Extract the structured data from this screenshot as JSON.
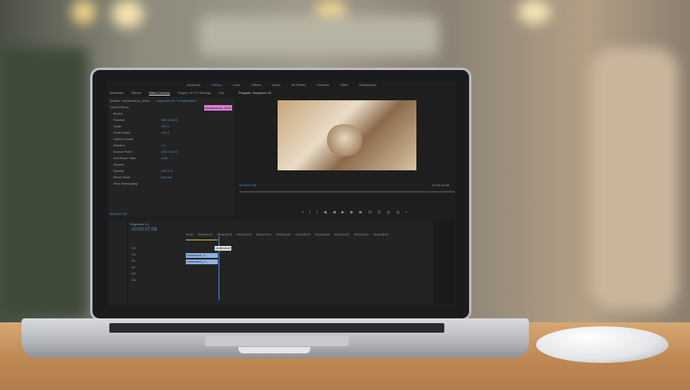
{
  "workspaces": [
    "Assembly",
    "Editing",
    "Color",
    "Effects",
    "Audio",
    "All Panels",
    "Libraries",
    "Titles",
    "Workspaces"
  ],
  "active_workspace": "Editing",
  "panel_tabs": [
    "Metadata",
    "Effects",
    "Effect Controls",
    "Project: SCTV Settings",
    "Sou"
  ],
  "program_tab": "Program: Sequence 01",
  "effect_controls": {
    "master": "Master * shutterstock_4246...",
    "sequence": "Sequence 01 * shutterstock...",
    "clip_label": "shutterstock_4246",
    "section": "Video Effects",
    "rows": [
      {
        "label": "Motion",
        "value": ""
      },
      {
        "label": "Position",
        "value": "960.0   540.0"
      },
      {
        "label": "Scale",
        "value": "100.0"
      },
      {
        "label": "Scale Width",
        "value": "100.0"
      },
      {
        "label": "Uniform Scale",
        "value": ""
      },
      {
        "label": "Rotation",
        "value": "0.0"
      },
      {
        "label": "Anchor Point",
        "value": "250.0   187.0"
      },
      {
        "label": "Anti-flicker Filter",
        "value": "0.00"
      },
      {
        "label": "Opacity",
        "value": ""
      },
      {
        "label": "Opacity",
        "value": "100.0 %"
      },
      {
        "label": "Blend Mode",
        "value": "Normal"
      },
      {
        "label": "Time Remapping",
        "value": ""
      }
    ],
    "timecode": "00:00:07:08"
  },
  "program": {
    "current": "00:00:07:08",
    "duration": "00:00:14:06"
  },
  "timeline": {
    "title": "Sequence 01",
    "timecode": "00:00:07:08",
    "ruler": [
      "00:00",
      "00:00:04:23",
      "00:00:09:23",
      "00:00:14:23",
      "00:00:19:23",
      "00:00:24:23",
      "00:00:29:23",
      "00:00:34:23",
      "00:00:39:23",
      "00:00:44:22",
      "00:00:49:22"
    ],
    "clips": [
      "shutterstock",
      "shutterstock_4...",
      "shutterstock_4..."
    ],
    "tracks": [
      "V3",
      "V2",
      "V1",
      "A1",
      "A2",
      "A3"
    ]
  },
  "colors": {
    "accent": "#4a8fd9",
    "clip": "#8fb3e0",
    "label": "#e07ad8"
  }
}
